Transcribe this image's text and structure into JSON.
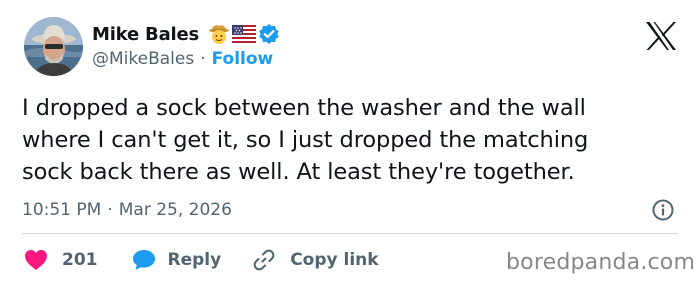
{
  "author": {
    "name": "Mike Bales",
    "handle": "@MikeBales",
    "separator": "·",
    "follow_label": "Follow",
    "badges": [
      "cowboy-face-emoji",
      "us-flag-emoji",
      "verified-badge"
    ],
    "verified_color": "#1d9bf0"
  },
  "tweet": {
    "lines": [
      "I dropped a sock between the washer and the wall",
      "where I can't get it, so I just dropped the matching",
      "sock back there as well. At least they're together."
    ],
    "time": "10:51 PM",
    "separator": "·",
    "date": "Mar 25, 2026"
  },
  "actions": {
    "like_count": "201",
    "reply_label": "Reply",
    "copy_link_label": "Copy link"
  },
  "watermark": "boredpanda.com",
  "colors": {
    "like": "#f91880",
    "reply": "#1d9bf0",
    "link": "#1d9bf0",
    "text": "#0f1419",
    "muted": "#536471"
  }
}
